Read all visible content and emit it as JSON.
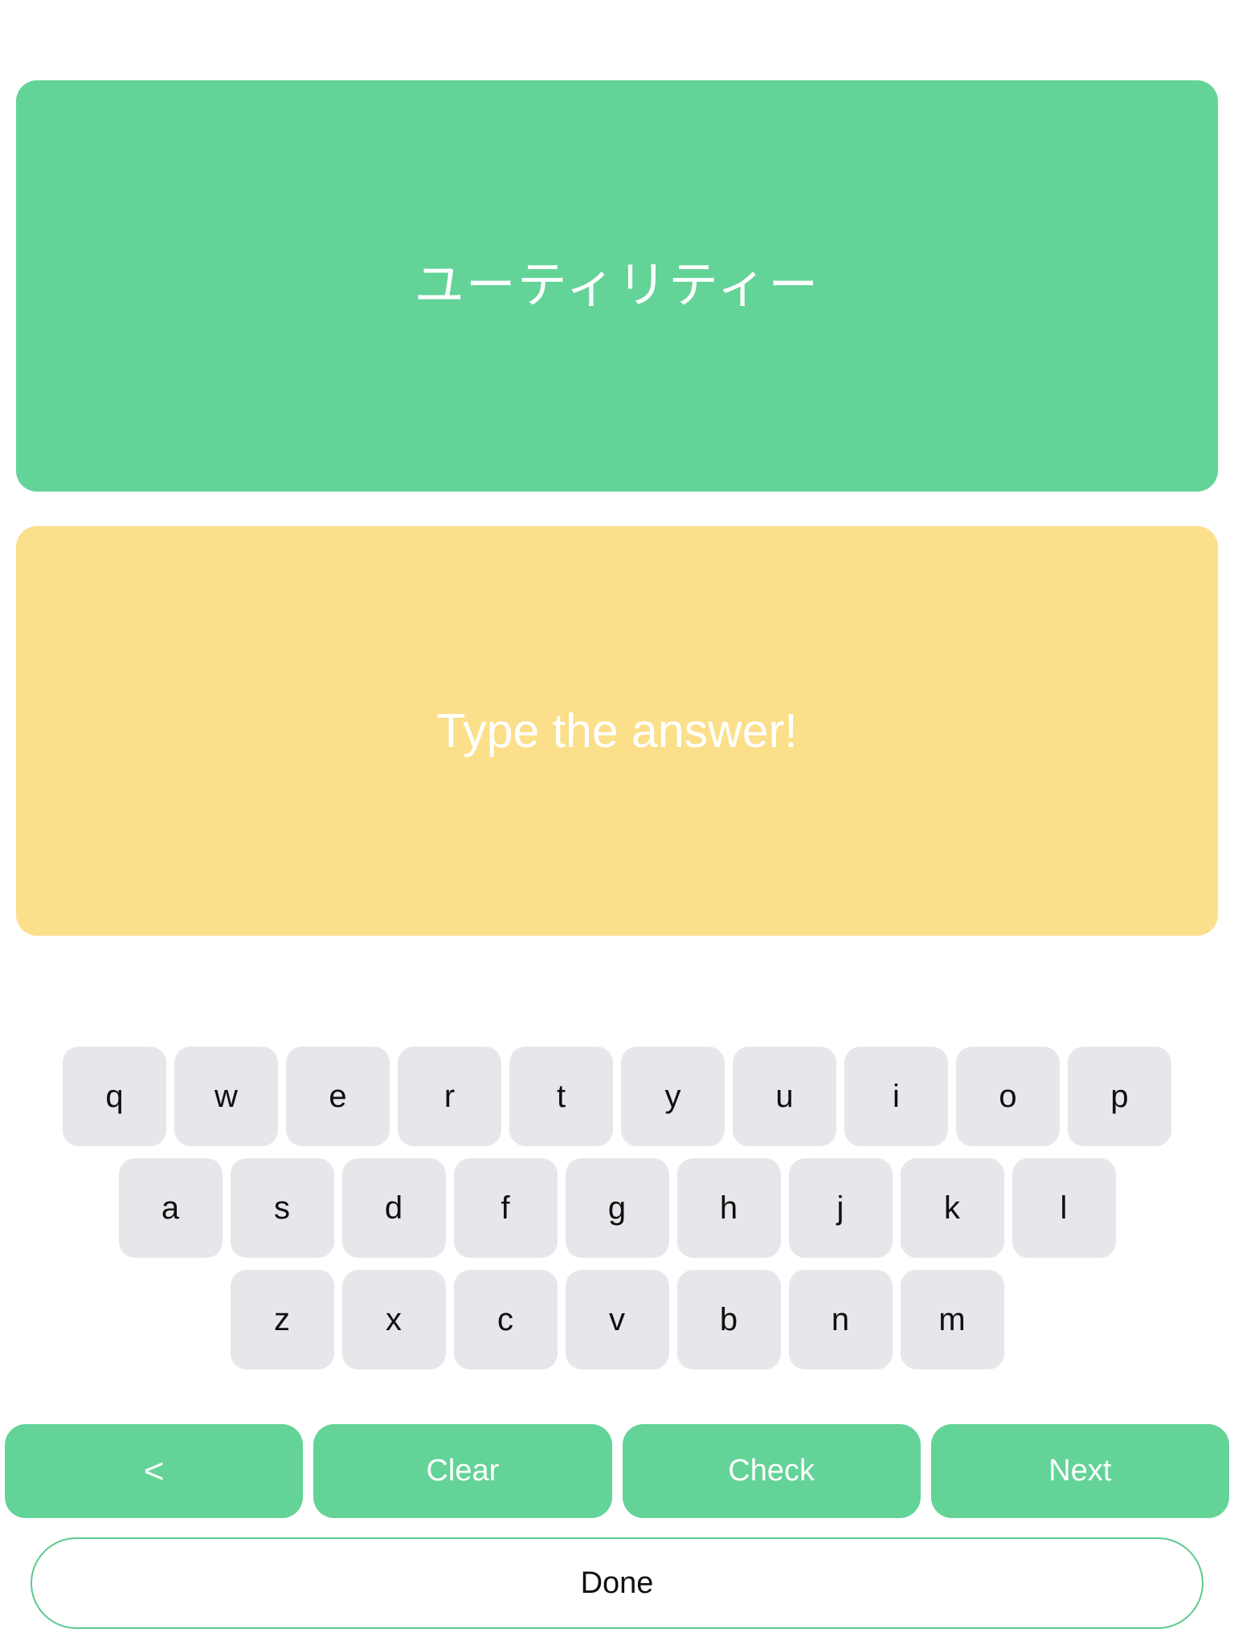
{
  "colors": {
    "green": "#63d397",
    "yellow": "#fbdf8a",
    "key_grey": "#e6e7ea",
    "done_border": "#5ec98e",
    "card_text": "#ffffff",
    "key_text": "#101010",
    "page_background": "#ffffff"
  },
  "prompt_card": {
    "text": "ユーティリティー"
  },
  "answer_card": {
    "text": "Type the answer!",
    "placeholder": "Type the answer!"
  },
  "keyboard": {
    "rows": [
      {
        "keys": [
          "q",
          "w",
          "e",
          "r",
          "t",
          "y",
          "u",
          "i",
          "o",
          "p"
        ]
      },
      {
        "keys": [
          "a",
          "s",
          "d",
          "f",
          "g",
          "h",
          "j",
          "k",
          "l"
        ]
      },
      {
        "keys": [
          "z",
          "x",
          "c",
          "v",
          "b",
          "n",
          "m"
        ]
      }
    ]
  },
  "action_bar": {
    "buttons": [
      {
        "label": "<",
        "name": "back-button",
        "icon": "chevron-left-icon"
      },
      {
        "label": "Clear",
        "name": "clear-button",
        "icon": null
      },
      {
        "label": "Check",
        "name": "check-button",
        "icon": null
      },
      {
        "label": "Next",
        "name": "next-button",
        "icon": null
      }
    ]
  },
  "done_button": {
    "label": "Done"
  }
}
